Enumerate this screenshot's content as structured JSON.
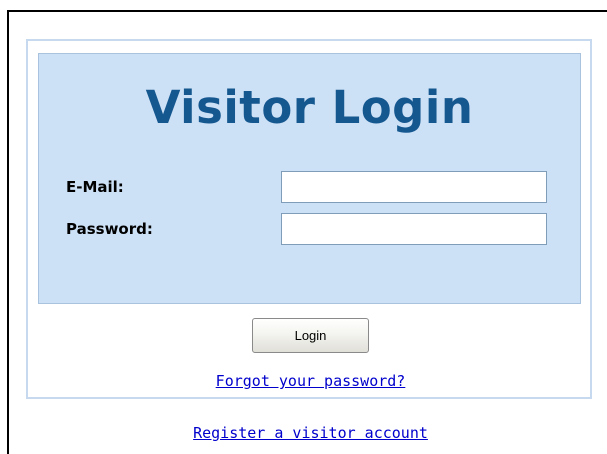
{
  "login": {
    "title": "Visitor Login",
    "email_label": "E-Mail:",
    "email_value": "",
    "password_label": "Password:",
    "password_value": "",
    "submit_label": "Login"
  },
  "links": {
    "forgot_password": "Forgot your password?",
    "register": "Register a visitor account"
  },
  "colors": {
    "panel_background": "#cce0f6",
    "title": "#15578f",
    "link": "#0000cc"
  }
}
